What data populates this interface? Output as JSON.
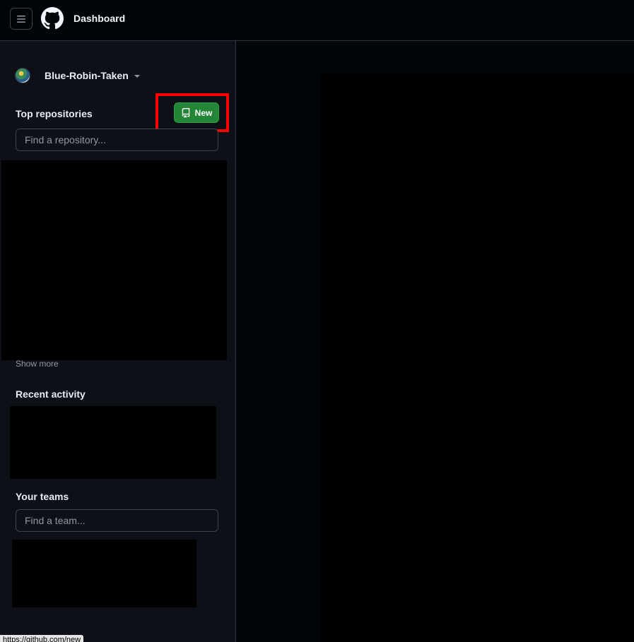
{
  "header": {
    "title": "Dashboard",
    "menu_icon": "hamburger-icon",
    "logo_icon": "github-logo-icon"
  },
  "sidebar": {
    "account": {
      "name": "Blue-Robin-Taken"
    },
    "top_repositories": {
      "title": "Top repositories",
      "new_label": "New",
      "search_placeholder": "Find a repository...",
      "show_more": "Show more"
    },
    "recent_activity": {
      "title": "Recent activity"
    },
    "teams": {
      "title": "Your teams",
      "search_placeholder": "Find a team..."
    }
  },
  "status_bar": {
    "url": "https://github.com/new"
  },
  "colors": {
    "primary_button": "#238636",
    "highlight": "#ff0000",
    "sidebar_bg": "#0d1117",
    "page_bg": "#010409"
  }
}
